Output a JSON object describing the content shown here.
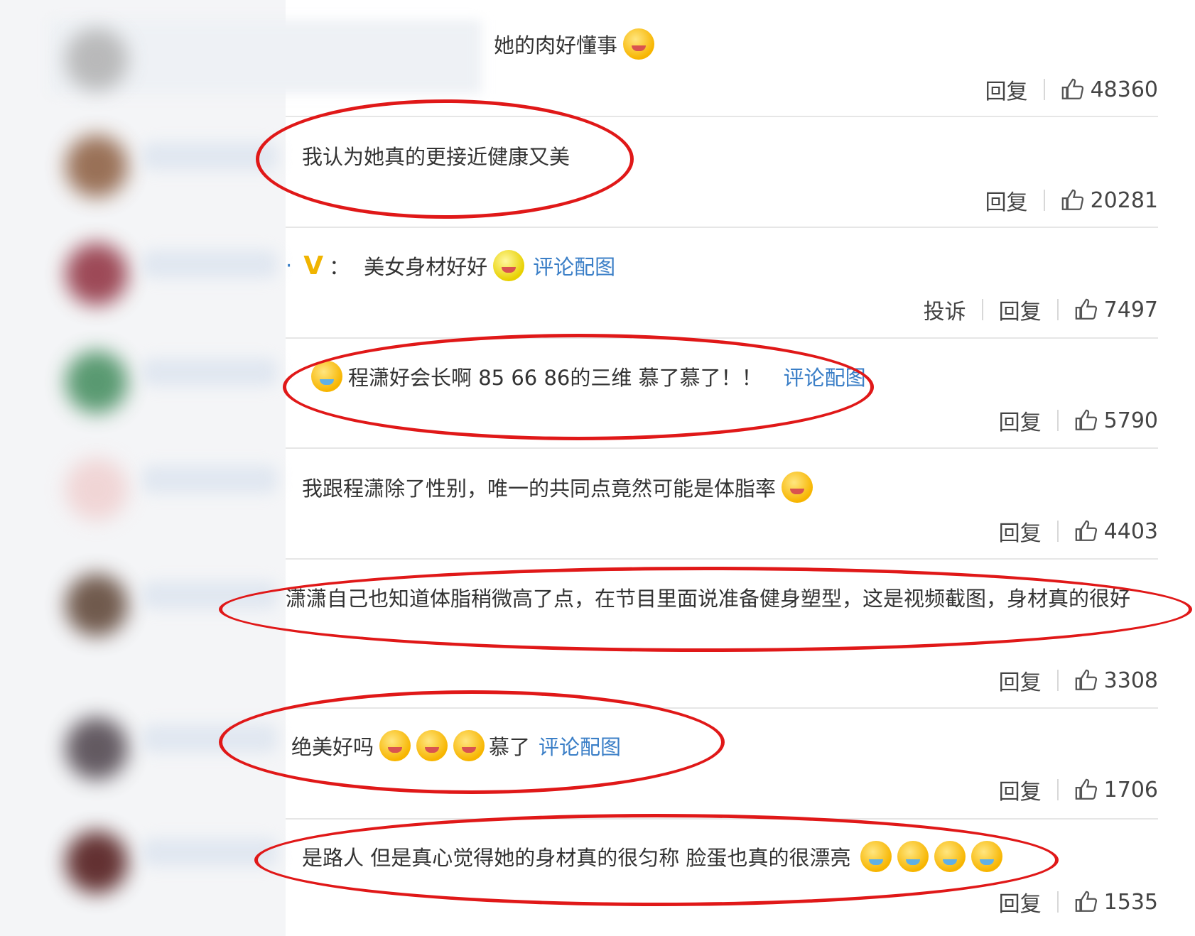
{
  "actions": {
    "reply_label": "回复",
    "report_label": "投诉"
  },
  "comments": [
    {
      "text": "她的肉好懂事",
      "emoji_after": [
        "flushed-face-emoji"
      ],
      "likes": "48360"
    },
    {
      "text": "我认为她真的更接近健康又美",
      "likes": "20281"
    },
    {
      "prefix": "·",
      "badge": "V",
      "colon": "：",
      "text": "美女身材好好",
      "link": "评论配图",
      "likes": "7497",
      "has_report": true
    },
    {
      "text": "程潇好会长啊 85 66 86的三维 慕了慕了！！",
      "link": "评论配图",
      "likes": "5790"
    },
    {
      "text": "我跟程潇除了性别，唯一的共同点竟然可能是体脂率",
      "likes": "4403"
    },
    {
      "text": "潇潇自己也知道体脂稍微高了点，在节目里面说准备健身塑型，这是视频截图，身材真的很好",
      "likes": "3308"
    },
    {
      "text": "绝美好吗",
      "text2": "慕了",
      "link": "评论配图",
      "likes": "1706"
    },
    {
      "text": "是路人 但是真心觉得她的身材真的很匀称 脸蛋也真的很漂亮",
      "likes": "1535"
    }
  ],
  "colors": {
    "link": "#3b7fc7",
    "annotation": "#e01818",
    "vip_badge": "#f0b400"
  }
}
